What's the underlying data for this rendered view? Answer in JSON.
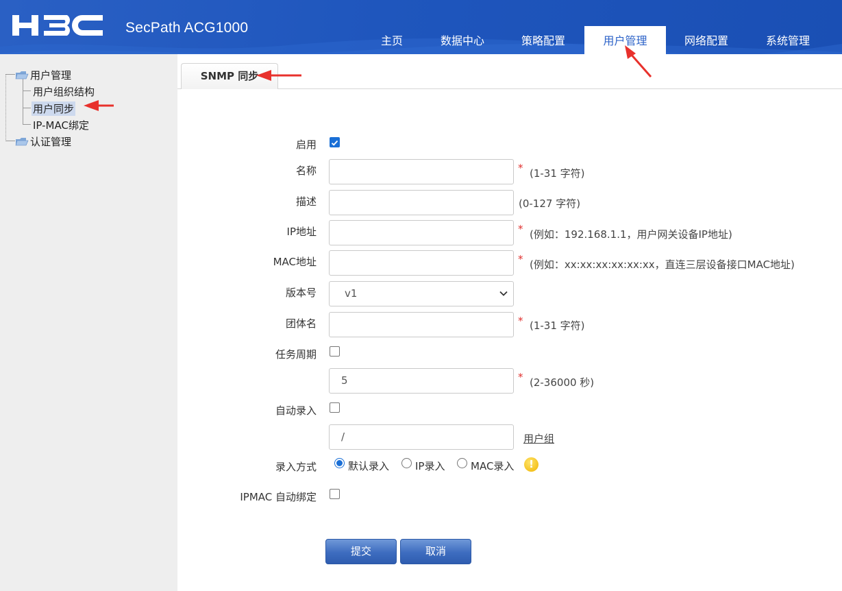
{
  "header": {
    "logo_text": "H3C",
    "product": "SecPath ACG1000",
    "nav": [
      "主页",
      "数据中心",
      "策略配置",
      "用户管理",
      "网络配置",
      "系统管理"
    ],
    "active_nav": "用户管理"
  },
  "sidebar": {
    "groups": [
      {
        "label": "用户管理",
        "children": [
          "用户组织结构",
          "用户同步",
          "IP-MAC绑定"
        ]
      },
      {
        "label": "认证管理",
        "children": []
      }
    ],
    "selected": "用户同步"
  },
  "tab": {
    "label": "SNMP 同步"
  },
  "form": {
    "enable": {
      "label": "启用",
      "checked": true
    },
    "name": {
      "label": "名称",
      "value": "",
      "hint": "(1-31 字符)",
      "required": true
    },
    "desc": {
      "label": "描述",
      "value": "",
      "hint": "(0-127 字符)",
      "required": false
    },
    "ip": {
      "label": "IP地址",
      "value": "",
      "hint": "(例如：192.168.1.1，用户网关设备IP地址)",
      "required": true
    },
    "mac": {
      "label": "MAC地址",
      "value": "",
      "hint": "(例如：xx:xx:xx:xx:xx:xx，直连三层设备接口MAC地址)",
      "required": true
    },
    "version": {
      "label": "版本号",
      "value": "v1"
    },
    "community": {
      "label": "团体名",
      "value": "",
      "hint": "(1-31 字符)",
      "required": true
    },
    "period": {
      "label": "任务周期",
      "checked": false,
      "value": "5",
      "hint": "(2-36000 秒)",
      "required": true
    },
    "auto_entry": {
      "label": "自动录入",
      "checked": false,
      "value": "/",
      "link": "用户组"
    },
    "entry_mode": {
      "label": "录入方式",
      "options": [
        "默认录入",
        "IP录入",
        "MAC录入"
      ],
      "selected": "默认录入"
    },
    "ipmac_bind": {
      "label": "IPMAC 自动绑定",
      "checked": false
    },
    "required_mark": "*",
    "submit": "提交",
    "cancel": "取消"
  },
  "colors": {
    "header_blue": "#1f56bd",
    "active_tab_text": "#2d63c8",
    "button_blue": "#3d6cbf",
    "required_red": "#e0312f",
    "annotation_red": "#e8312c"
  }
}
